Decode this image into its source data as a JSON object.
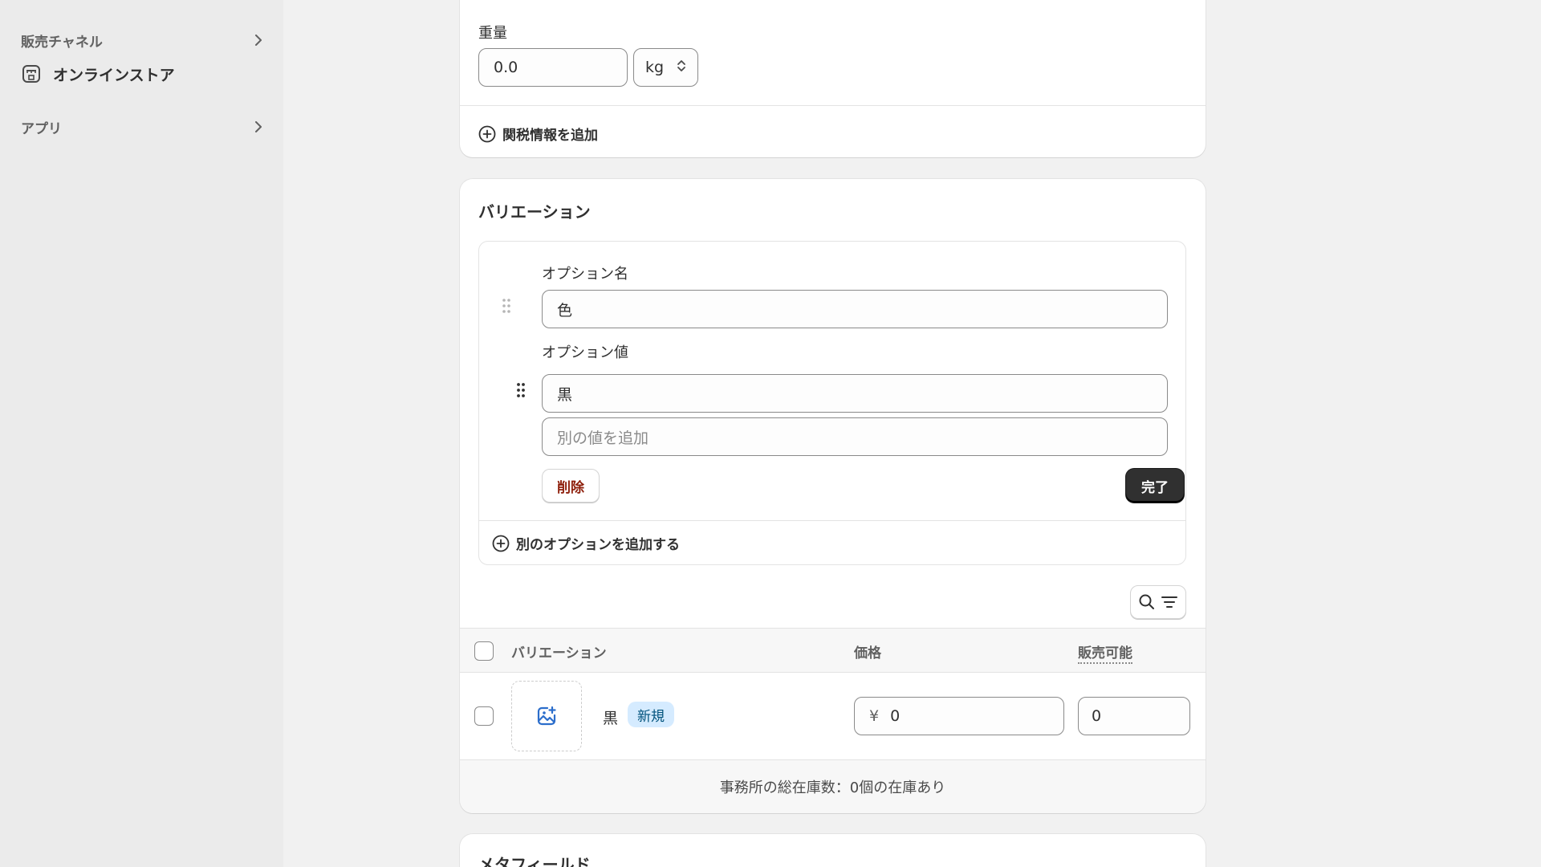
{
  "sidebar": {
    "sales_channels_label": "販売チャネル",
    "online_store_label": "オンラインストア",
    "apps_label": "アプリ"
  },
  "weight_card": {
    "weight_label": "重量",
    "weight_value": "0.0",
    "unit_value": "kg",
    "customs_link": "関税情報を追加"
  },
  "variants_card": {
    "title": "バリエーション",
    "option_name_label": "オプション名",
    "option_name_value": "色",
    "option_values_label": "オプション値",
    "option_value_1": "黒",
    "add_value_placeholder": "別の値を追加",
    "delete_button": "削除",
    "done_button": "完了",
    "add_option_link": "別のオプションを追加する",
    "table": {
      "headers": {
        "variation": "バリエーション",
        "price": "価格",
        "available": "販売可能"
      },
      "rows": [
        {
          "name": "黒",
          "badge": "新規",
          "currency": "¥",
          "price": "0",
          "available": "0"
        }
      ],
      "footer": "事務所の総在庫数：0個の在庫あり"
    }
  },
  "metafields_card": {
    "title": "メタフィールド"
  },
  "colors": {
    "done_button_bg": "#303030",
    "delete_text": "#8e1f0b",
    "badge_bg": "#d5ebff",
    "image_icon": "#2c6ecb"
  }
}
